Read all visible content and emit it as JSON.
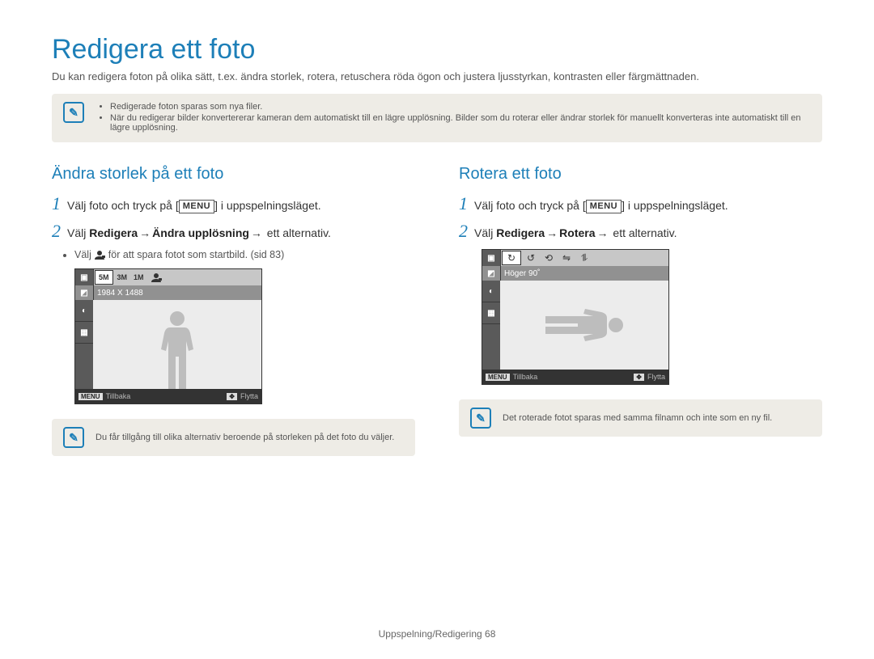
{
  "title": "Redigera ett foto",
  "subtitle": "Du kan redigera foton på olika sätt, t.ex. ändra storlek, rotera, retuschera röda ögon och justera ljusstyrkan, kontrasten eller färgmättnaden.",
  "top_note": {
    "bullets": [
      "Redigerade foton sparas som nya filer.",
      "När du redigerar bilder konvertererar kameran dem automatiskt till en lägre upplösning. Bilder som du roterar eller ändrar storlek för manuellt konverteras inte automatiskt till en lägre upplösning."
    ]
  },
  "left": {
    "heading": "Ändra storlek på ett foto",
    "step1_pre": "Välj foto och tryck på [",
    "step1_key": "MENU",
    "step1_post": "] i uppspelningsläget.",
    "step2_pre": "Välj ",
    "step2_b1": "Redigera",
    "step2_arrow": "→",
    "step2_b2": "Ändra upplösning",
    "step2_post": " ett alternativ.",
    "sub_pre": "Välj ",
    "sub_post": " för att spara fotot som startbild. (sid 83)",
    "lcd": {
      "chips": [
        "5M",
        "3M",
        "1M"
      ],
      "label": "1984 X 1488",
      "bottom_key1": "MENU",
      "bottom_lbl1": "Tillbaka",
      "bottom_lbl2": "Flytta"
    },
    "bottom_note": "Du får tillgång till olika alternativ beroende på storleken på det foto du väljer."
  },
  "right": {
    "heading": "Rotera ett foto",
    "step1_pre": "Välj foto och tryck på [",
    "step1_key": "MENU",
    "step1_post": "] i uppspelningsläget.",
    "step2_pre": "Välj ",
    "step2_b1": "Redigera",
    "step2_arrow": "→",
    "step2_b2": "Rotera",
    "step2_post": " ett alternativ.",
    "lcd": {
      "label": "Höger 90˚",
      "bottom_key1": "MENU",
      "bottom_lbl1": "Tillbaka",
      "bottom_lbl2": "Flytta"
    },
    "bottom_note": "Det roterade fotot sparas med samma filnamn och inte som en ny fil."
  },
  "footer": "Uppspelning/Redigering  68"
}
